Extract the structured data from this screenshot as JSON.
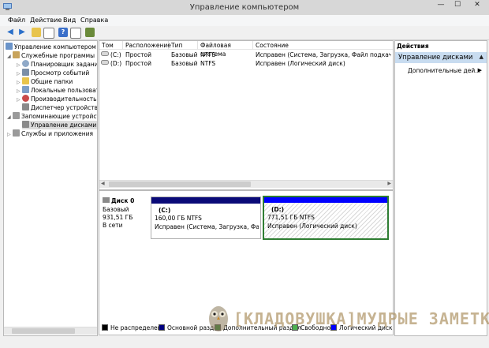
{
  "window": {
    "title": "Управление компьютером",
    "minimize": "—",
    "maximize": "☐",
    "close": "✕"
  },
  "menu": [
    "Файл",
    "Действие",
    "Вид",
    "Справка"
  ],
  "tree": {
    "root": "Управление компьютером (л",
    "items": [
      {
        "label": "Служебные программы",
        "indent": 1,
        "expanded": true,
        "icon": "tools-icon"
      },
      {
        "label": "Планировщик заданий",
        "indent": 2,
        "icon": "clock-icon"
      },
      {
        "label": "Просмотр событий",
        "indent": 2,
        "icon": "event-viewer-icon"
      },
      {
        "label": "Общие папки",
        "indent": 2,
        "icon": "shared-folder-icon"
      },
      {
        "label": "Локальные пользовате",
        "indent": 2,
        "icon": "users-icon"
      },
      {
        "label": "Производительность",
        "indent": 2,
        "icon": "performance-icon"
      },
      {
        "label": "Диспетчер устройств",
        "indent": 2,
        "icon": "device-manager-icon"
      },
      {
        "label": "Запоминающие устройст",
        "indent": 1,
        "expanded": true,
        "icon": "storage-icon"
      },
      {
        "label": "Управление дисками",
        "indent": 2,
        "icon": "disk-management-icon",
        "selected": true
      },
      {
        "label": "Службы и приложения",
        "indent": 1,
        "icon": "services-icon"
      }
    ]
  },
  "volumes": {
    "columns": [
      "Том",
      "Расположение",
      "Тип",
      "Файловая система",
      "Состояние"
    ],
    "rows": [
      [
        "(C:)",
        "Простой",
        "Базовый",
        "NTFS",
        "Исправен (Система, Загрузка, Файл подкачки, Ак"
      ],
      [
        "(D:)",
        "Простой",
        "Базовый",
        "NTFS",
        "Исправен (Логический диск)"
      ]
    ]
  },
  "disk": {
    "name": "Диск 0",
    "type": "Базовый",
    "size": "931,51 ГБ",
    "status": "В сети",
    "partitions": [
      {
        "label": "(C:)",
        "size": "160,00 ГБ NTFS",
        "status": "Исправен (Система, Загрузка, Файл пс"
      },
      {
        "label": "(D:)",
        "size": "771,51 ГБ NTFS",
        "status": "Исправен (Логический диск)"
      }
    ]
  },
  "legend": [
    {
      "label": "Не распределена",
      "color": "#000000"
    },
    {
      "label": "Основной раздел",
      "color": "#000080"
    },
    {
      "label": "Дополнительный раздел",
      "color": "#2e7d32"
    },
    {
      "label": "Свободно",
      "color": "#4caf50"
    },
    {
      "label": "Логический диск",
      "color": "#0000ff"
    }
  ],
  "actions": {
    "header": "Действия",
    "section": "Управление дисками",
    "more": "Дополнительные дей..."
  },
  "watermark": "[КЛАДОВУШКА]МУДРЫЕ ЗАМЕТКИ",
  "colors": {
    "primary_bar": "#0a0a78",
    "logical_bar": "#0000ff",
    "extended_border": "#2e7d32",
    "action_header_bg": "#c8dcf0"
  }
}
